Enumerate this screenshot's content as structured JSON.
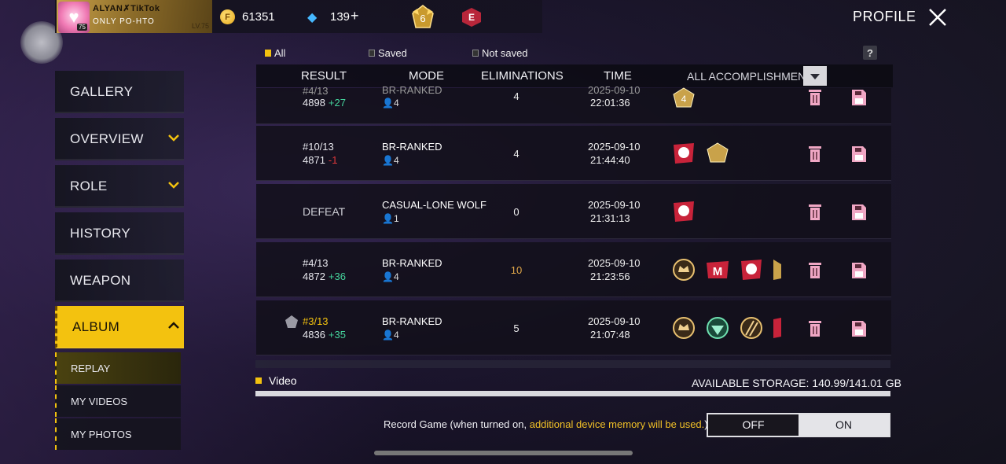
{
  "topbar": {
    "banner_name": "ALYAN✗TikTok",
    "banner_only": "ONLY",
    "banner_sub": "PO-HTO",
    "banner_rank": "LV.75",
    "avatar_level": "75",
    "avatar_icon": "heart-face-icon",
    "coins": "61351",
    "diamonds": "139",
    "diamond_plus": "+",
    "rank_number": "6",
    "elite_letter": "E",
    "title": "PROFILE"
  },
  "sidebar": {
    "items": [
      {
        "label": "GALLERY",
        "chevron": false
      },
      {
        "label": "OVERVIEW",
        "chevron": true
      },
      {
        "label": "ROLE",
        "chevron": true
      },
      {
        "label": "HISTORY",
        "chevron": false
      },
      {
        "label": "WEAPON",
        "chevron": false
      },
      {
        "label": "ALBUM",
        "chevron": true,
        "active": true
      }
    ],
    "subitems": [
      {
        "label": "REPLAY",
        "active": true
      },
      {
        "label": "MY VIDEOS"
      },
      {
        "label": "MY PHOTOS"
      }
    ]
  },
  "filters": {
    "all": "All",
    "saved": "Saved",
    "not_saved": "Not saved"
  },
  "table": {
    "headers": {
      "result": "RESULT",
      "mode": "MODE",
      "eliminations": "ELIMINATIONS",
      "time": "TIME",
      "accomplishments": "ALL ACCOMPLISHMENTS"
    },
    "rows": [
      {
        "rank": "#4/13",
        "points": "4898",
        "delta": "+27",
        "mode": "BR-RANKED",
        "players": "4",
        "elims": "4",
        "date": "2025-09-10",
        "time": "22:01:36"
      },
      {
        "rank": "#10/13",
        "points": "4871",
        "delta": "-1",
        "mode": "BR-RANKED",
        "players": "4",
        "elims": "4",
        "date": "2025-09-10",
        "time": "21:44:40"
      },
      {
        "result": "DEFEAT",
        "mode": "CASUAL-LONE WOLF",
        "players": "1",
        "elims": "0",
        "date": "2025-09-10",
        "time": "21:31:13"
      },
      {
        "rank": "#4/13",
        "points": "4872",
        "delta": "+36",
        "mode": "BR-RANKED",
        "players": "4",
        "elims": "10",
        "date": "2025-09-10",
        "time": "21:23:56"
      },
      {
        "rank": "#3/13",
        "points": "4836",
        "delta": "+35",
        "mode": "BR-RANKED",
        "players": "4",
        "elims": "5",
        "date": "2025-09-10",
        "time": "21:07:48"
      }
    ]
  },
  "storage": {
    "video_label": "Video",
    "available": "AVAILABLE STORAGE: 140.99/141.01 GB",
    "used_fraction": 0.9998
  },
  "record": {
    "text_prefix": "Record Game (when turned on, ",
    "text_highlight": "additional device memory will be used.",
    "text_suffix": ")",
    "off": "OFF",
    "on": "ON"
  },
  "colors": {
    "accent": "#f3c20f",
    "positive": "#45d49c",
    "negative": "#e0383b",
    "trash": "#f0a7c4"
  }
}
